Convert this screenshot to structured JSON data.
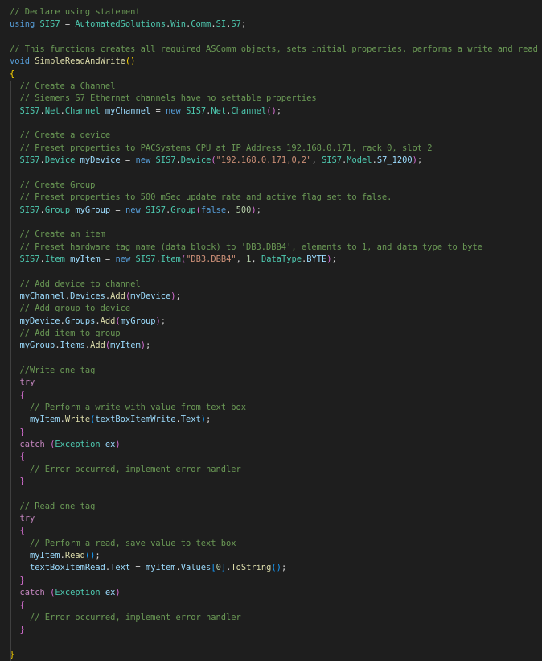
{
  "colors": {
    "background": "#1e1e1e",
    "comment": "#6a9955",
    "keyword": "#569cd6",
    "control_keyword": "#c586c0",
    "type": "#4ec9b0",
    "variable": "#9cdcfe",
    "function": "#dcdcaa",
    "string": "#ce9178",
    "number": "#b5cea8",
    "default": "#d4d4d4",
    "bracket_level1": "#ffd700",
    "bracket_level2": "#da70d6",
    "bracket_level3": "#179fff"
  },
  "code_lines": [
    [
      [
        "c",
        "// Declare using statement"
      ]
    ],
    [
      [
        "k",
        "using"
      ],
      [
        "p",
        " "
      ],
      [
        "t",
        "SIS7"
      ],
      [
        "p",
        " = "
      ],
      [
        "t",
        "AutomatedSolutions"
      ],
      [
        "p",
        "."
      ],
      [
        "t",
        "Win"
      ],
      [
        "p",
        "."
      ],
      [
        "t",
        "Comm"
      ],
      [
        "p",
        "."
      ],
      [
        "t",
        "SI"
      ],
      [
        "p",
        "."
      ],
      [
        "t",
        "S7"
      ],
      [
        "p",
        ";"
      ]
    ],
    [],
    [
      [
        "c",
        "// This functions creates all required ASComm objects, sets initial properties, performs a write and read"
      ]
    ],
    [
      [
        "k",
        "void"
      ],
      [
        "p",
        " "
      ],
      [
        "f",
        "SimpleReadAndWrite"
      ],
      [
        "b1",
        "()"
      ]
    ],
    [
      [
        "b1",
        "{"
      ]
    ],
    [
      [
        "p",
        "  "
      ],
      [
        "c",
        "// Create a Channel"
      ]
    ],
    [
      [
        "p",
        "  "
      ],
      [
        "c",
        "// Siemens S7 Ethernet channels have no settable properties"
      ]
    ],
    [
      [
        "p",
        "  "
      ],
      [
        "t",
        "SIS7"
      ],
      [
        "p",
        "."
      ],
      [
        "t",
        "Net"
      ],
      [
        "p",
        "."
      ],
      [
        "t",
        "Channel"
      ],
      [
        "p",
        " "
      ],
      [
        "v",
        "myChannel"
      ],
      [
        "p",
        " = "
      ],
      [
        "k",
        "new"
      ],
      [
        "p",
        " "
      ],
      [
        "t",
        "SIS7"
      ],
      [
        "p",
        "."
      ],
      [
        "t",
        "Net"
      ],
      [
        "p",
        "."
      ],
      [
        "t",
        "Channel"
      ],
      [
        "b2",
        "()"
      ],
      [
        "p",
        ";"
      ]
    ],
    [],
    [
      [
        "p",
        "  "
      ],
      [
        "c",
        "// Create a device"
      ]
    ],
    [
      [
        "p",
        "  "
      ],
      [
        "c",
        "// Preset properties to PACSystems CPU at IP Address 192.168.0.171, rack 0, slot 2"
      ]
    ],
    [
      [
        "p",
        "  "
      ],
      [
        "t",
        "SIS7"
      ],
      [
        "p",
        "."
      ],
      [
        "t",
        "Device"
      ],
      [
        "p",
        " "
      ],
      [
        "v",
        "myDevice"
      ],
      [
        "p",
        " = "
      ],
      [
        "k",
        "new"
      ],
      [
        "p",
        " "
      ],
      [
        "t",
        "SIS7"
      ],
      [
        "p",
        "."
      ],
      [
        "t",
        "Device"
      ],
      [
        "b2",
        "("
      ],
      [
        "s",
        "\"192.168.0.171,0,2\""
      ],
      [
        "p",
        ", "
      ],
      [
        "t",
        "SIS7"
      ],
      [
        "p",
        "."
      ],
      [
        "t",
        "Model"
      ],
      [
        "p",
        "."
      ],
      [
        "v",
        "S7_1200"
      ],
      [
        "b2",
        ")"
      ],
      [
        "p",
        ";"
      ]
    ],
    [],
    [
      [
        "p",
        "  "
      ],
      [
        "c",
        "// Create Group"
      ]
    ],
    [
      [
        "p",
        "  "
      ],
      [
        "c",
        "// Preset properties to 500 mSec update rate and active flag set to false."
      ]
    ],
    [
      [
        "p",
        "  "
      ],
      [
        "t",
        "SIS7"
      ],
      [
        "p",
        "."
      ],
      [
        "t",
        "Group"
      ],
      [
        "p",
        " "
      ],
      [
        "v",
        "myGroup"
      ],
      [
        "p",
        " = "
      ],
      [
        "k",
        "new"
      ],
      [
        "p",
        " "
      ],
      [
        "t",
        "SIS7"
      ],
      [
        "p",
        "."
      ],
      [
        "t",
        "Group"
      ],
      [
        "b2",
        "("
      ],
      [
        "k",
        "false"
      ],
      [
        "p",
        ", "
      ],
      [
        "n",
        "500"
      ],
      [
        "b2",
        ")"
      ],
      [
        "p",
        ";"
      ]
    ],
    [],
    [
      [
        "p",
        "  "
      ],
      [
        "c",
        "// Create an item"
      ]
    ],
    [
      [
        "p",
        "  "
      ],
      [
        "c",
        "// Preset hardware tag name (data block) to 'DB3.DBB4', elements to 1, and data type to byte"
      ]
    ],
    [
      [
        "p",
        "  "
      ],
      [
        "t",
        "SIS7"
      ],
      [
        "p",
        "."
      ],
      [
        "t",
        "Item"
      ],
      [
        "p",
        " "
      ],
      [
        "v",
        "myItem"
      ],
      [
        "p",
        " = "
      ],
      [
        "k",
        "new"
      ],
      [
        "p",
        " "
      ],
      [
        "t",
        "SIS7"
      ],
      [
        "p",
        "."
      ],
      [
        "t",
        "Item"
      ],
      [
        "b2",
        "("
      ],
      [
        "s",
        "\"DB3.DBB4\""
      ],
      [
        "p",
        ", "
      ],
      [
        "n",
        "1"
      ],
      [
        "p",
        ", "
      ],
      [
        "t",
        "DataType"
      ],
      [
        "p",
        "."
      ],
      [
        "v",
        "BYTE"
      ],
      [
        "b2",
        ")"
      ],
      [
        "p",
        ";"
      ]
    ],
    [],
    [
      [
        "p",
        "  "
      ],
      [
        "c",
        "// Add device to channel"
      ]
    ],
    [
      [
        "p",
        "  "
      ],
      [
        "v",
        "myChannel"
      ],
      [
        "p",
        "."
      ],
      [
        "v",
        "Devices"
      ],
      [
        "p",
        "."
      ],
      [
        "f",
        "Add"
      ],
      [
        "b2",
        "("
      ],
      [
        "v",
        "myDevice"
      ],
      [
        "b2",
        ")"
      ],
      [
        "p",
        ";"
      ]
    ],
    [
      [
        "p",
        "  "
      ],
      [
        "c",
        "// Add group to device"
      ]
    ],
    [
      [
        "p",
        "  "
      ],
      [
        "v",
        "myDevice"
      ],
      [
        "p",
        "."
      ],
      [
        "v",
        "Groups"
      ],
      [
        "p",
        "."
      ],
      [
        "f",
        "Add"
      ],
      [
        "b2",
        "("
      ],
      [
        "v",
        "myGroup"
      ],
      [
        "b2",
        ")"
      ],
      [
        "p",
        ";"
      ]
    ],
    [
      [
        "p",
        "  "
      ],
      [
        "c",
        "// Add item to group"
      ]
    ],
    [
      [
        "p",
        "  "
      ],
      [
        "v",
        "myGroup"
      ],
      [
        "p",
        "."
      ],
      [
        "v",
        "Items"
      ],
      [
        "p",
        "."
      ],
      [
        "f",
        "Add"
      ],
      [
        "b2",
        "("
      ],
      [
        "v",
        "myItem"
      ],
      [
        "b2",
        ")"
      ],
      [
        "p",
        ";"
      ]
    ],
    [],
    [
      [
        "p",
        "  "
      ],
      [
        "c",
        "//Write one tag"
      ]
    ],
    [
      [
        "p",
        "  "
      ],
      [
        "ck",
        "try"
      ]
    ],
    [
      [
        "p",
        "  "
      ],
      [
        "b2",
        "{"
      ]
    ],
    [
      [
        "p",
        "    "
      ],
      [
        "c",
        "// Perform a write with value from text box"
      ]
    ],
    [
      [
        "p",
        "    "
      ],
      [
        "v",
        "myItem"
      ],
      [
        "p",
        "."
      ],
      [
        "f",
        "Write"
      ],
      [
        "b3",
        "("
      ],
      [
        "v",
        "textBoxItemWrite"
      ],
      [
        "p",
        "."
      ],
      [
        "v",
        "Text"
      ],
      [
        "b3",
        ")"
      ],
      [
        "p",
        ";"
      ]
    ],
    [
      [
        "p",
        "  "
      ],
      [
        "b2",
        "}"
      ]
    ],
    [
      [
        "p",
        "  "
      ],
      [
        "ck",
        "catch"
      ],
      [
        "p",
        " "
      ],
      [
        "b2",
        "("
      ],
      [
        "t",
        "Exception"
      ],
      [
        "p",
        " "
      ],
      [
        "v",
        "ex"
      ],
      [
        "b2",
        ")"
      ]
    ],
    [
      [
        "p",
        "  "
      ],
      [
        "b2",
        "{"
      ]
    ],
    [
      [
        "p",
        "    "
      ],
      [
        "c",
        "// Error occurred, implement error handler"
      ]
    ],
    [
      [
        "p",
        "  "
      ],
      [
        "b2",
        "}"
      ]
    ],
    [],
    [
      [
        "p",
        "  "
      ],
      [
        "c",
        "// Read one tag"
      ]
    ],
    [
      [
        "p",
        "  "
      ],
      [
        "ck",
        "try"
      ]
    ],
    [
      [
        "p",
        "  "
      ],
      [
        "b2",
        "{"
      ]
    ],
    [
      [
        "p",
        "    "
      ],
      [
        "c",
        "// Perform a read, save value to text box"
      ]
    ],
    [
      [
        "p",
        "    "
      ],
      [
        "v",
        "myItem"
      ],
      [
        "p",
        "."
      ],
      [
        "f",
        "Read"
      ],
      [
        "b3",
        "()"
      ],
      [
        "p",
        ";"
      ]
    ],
    [
      [
        "p",
        "    "
      ],
      [
        "v",
        "textBoxItemRead"
      ],
      [
        "p",
        "."
      ],
      [
        "v",
        "Text"
      ],
      [
        "p",
        " = "
      ],
      [
        "v",
        "myItem"
      ],
      [
        "p",
        "."
      ],
      [
        "v",
        "Values"
      ],
      [
        "b3",
        "["
      ],
      [
        "n",
        "0"
      ],
      [
        "b3",
        "]"
      ],
      [
        "p",
        "."
      ],
      [
        "f",
        "ToString"
      ],
      [
        "b3",
        "()"
      ],
      [
        "p",
        ";"
      ]
    ],
    [
      [
        "p",
        "  "
      ],
      [
        "b2",
        "}"
      ]
    ],
    [
      [
        "p",
        "  "
      ],
      [
        "ck",
        "catch"
      ],
      [
        "p",
        " "
      ],
      [
        "b2",
        "("
      ],
      [
        "t",
        "Exception"
      ],
      [
        "p",
        " "
      ],
      [
        "v",
        "ex"
      ],
      [
        "b2",
        ")"
      ]
    ],
    [
      [
        "p",
        "  "
      ],
      [
        "b2",
        "{"
      ]
    ],
    [
      [
        "p",
        "    "
      ],
      [
        "c",
        "// Error occurred, implement error handler"
      ]
    ],
    [
      [
        "p",
        "  "
      ],
      [
        "b2",
        "}"
      ]
    ],
    [],
    [
      [
        "b1",
        "}"
      ]
    ]
  ]
}
